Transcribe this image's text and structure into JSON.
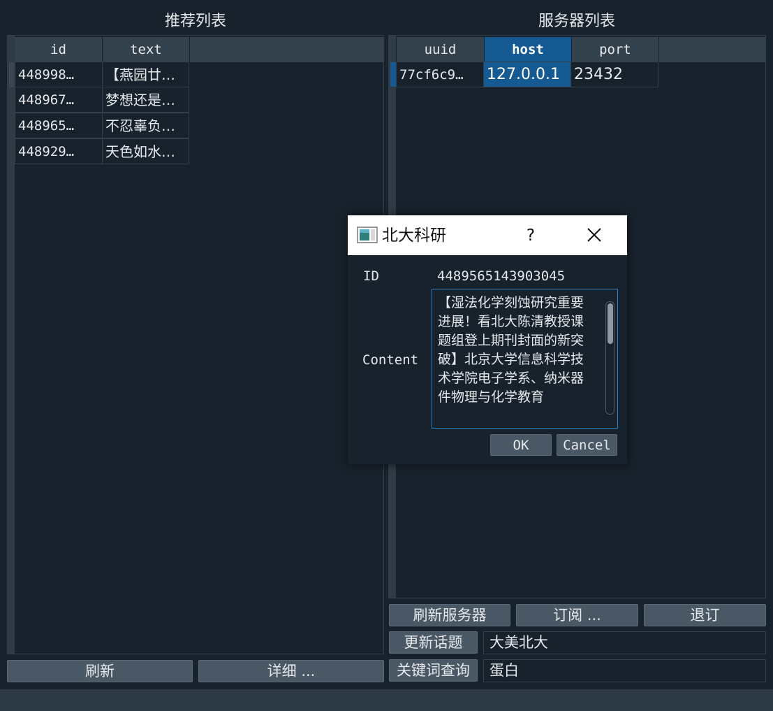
{
  "left": {
    "title": "推荐列表",
    "columns": [
      "id",
      "text"
    ],
    "rows": [
      {
        "id": "448998…",
        "text": "【燕园廿…"
      },
      {
        "id": "448967…",
        "text": "梦想还是…"
      },
      {
        "id": "448965…",
        "text": "不忍辜负…"
      },
      {
        "id": "448929…",
        "text": "天色如水…"
      }
    ],
    "buttons": {
      "refresh": "刷新",
      "detail": "详细 ..."
    }
  },
  "right": {
    "title": "服务器列表",
    "columns": [
      "uuid",
      "host",
      "port"
    ],
    "rows": [
      {
        "uuid": "77cf6c9…",
        "host": "127.0.0.1",
        "port": "23432"
      }
    ],
    "buttons": {
      "refresh_servers": "刷新服务器",
      "subscribe": "订阅 ...",
      "unsubscribe": "退订",
      "update_topic": "更新话题",
      "keyword_query": "关键词查询"
    },
    "fields": {
      "topic": "大美北大",
      "keyword": "蛋白"
    }
  },
  "dialog": {
    "title": "北大科研",
    "help": "?",
    "id_label": "ID",
    "id_value": "4489565143903045",
    "content_label": "Content",
    "content_text": "【湿法化学刻蚀研究重要进展！看北大陈清教授课题组登上期刊封面的新突破】北京大学信息科学技术学院电子学系、纳米器件物理与化学教育",
    "ok": "OK",
    "cancel": "Cancel"
  },
  "colors": {
    "background": "#18222c",
    "header": "#33414c",
    "selection": "#155a93",
    "button": "#4a5866",
    "focus_border": "#2a82c7"
  },
  "icons": [
    "app-window-icon",
    "help-icon",
    "close-icon"
  ]
}
